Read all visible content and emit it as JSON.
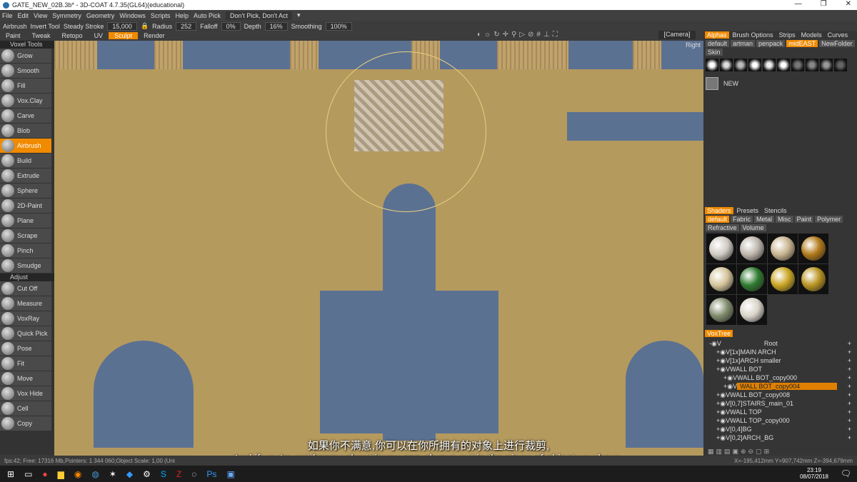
{
  "title": "GATE_NEW_02B.3b* - 3D-COAT 4.7.35(GL64)(educational)",
  "menu": [
    "File",
    "Edit",
    "View",
    "Symmetry",
    "Geometry",
    "Windows",
    "Scripts",
    "Help"
  ],
  "auto_pick": "Auto Pick",
  "pick_mode": "Don't Pick, Don't Act",
  "toolopts": {
    "tool": "Airbrush",
    "invert": "Invert Tool",
    "steady": "Steady Stroke",
    "steady_val": "15,000",
    "radius": "Radius",
    "radius_val": "252",
    "falloff": "Falloff",
    "falloff_val": "0%",
    "depth": "Depth",
    "depth_val": "16%",
    "smoothing": "Smoothing",
    "smoothing_val": "100%"
  },
  "rooms": [
    "Paint",
    "Tweak",
    "Retopo",
    "UV",
    "Sculpt",
    "Render"
  ],
  "camera": "[Camera]",
  "view_label": "Right",
  "left": {
    "voxel_header": "Voxel Tools",
    "tools": [
      "Grow",
      "Smooth",
      "Fill",
      "Vox.Clay",
      "Carve",
      "Blob",
      "Airbrush",
      "Build",
      "Extrude",
      "Sphere",
      "2D-Paint",
      "Plane",
      "Scrape",
      "Pinch",
      "Smudge"
    ],
    "adjust_header": "Adjust",
    "adjust": [
      "Cut Off",
      "Measure",
      "VoxRay",
      "Quick Pick",
      "Pose",
      "Fit",
      "Move",
      "Vox Hide",
      "Cell",
      "Copy"
    ]
  },
  "alphas": {
    "tabs": [
      "Alphas",
      "Brush Options",
      "Strips",
      "Models",
      "Curves"
    ],
    "folders": [
      "default",
      "artman",
      "penpack",
      "midEAST",
      "NewFolder",
      "Skin"
    ],
    "new": "NEW"
  },
  "shaders": {
    "tabs": [
      "Shaders",
      "Presets",
      "Stencils"
    ],
    "cats": [
      "default",
      "Fabric",
      "Metal",
      "Misc",
      "Paint",
      "Polymer",
      "Refractive",
      "Volume"
    ],
    "colors": [
      "#cfcac2",
      "#bdb6ad",
      "#c8b48f",
      "#b07818",
      "#d4c49a",
      "#2f7a2f",
      "#c9a422",
      "#b89320",
      "#7f8b6c",
      "#d9d3c8"
    ]
  },
  "voxtree": {
    "title": "VoxTree",
    "items": [
      {
        "name": "Root",
        "indent": 0
      },
      {
        "name": "[1x]MAIN  ARCH",
        "indent": 1
      },
      {
        "name": "[1x]ARCH  smaller",
        "indent": 1
      },
      {
        "name": "WALL  BOT",
        "indent": 1
      },
      {
        "name": "WALL  BOT_copy000",
        "indent": 2
      },
      {
        "name": "WALL  BOT_copy004",
        "indent": 2,
        "selected": true
      },
      {
        "name": "WALL  BOT_copy008",
        "indent": 1
      },
      {
        "name": "[0,7]STAIRS_main_01",
        "indent": 1
      },
      {
        "name": "WALL  TOP",
        "indent": 1
      },
      {
        "name": "WALL  TOP_copy000",
        "indent": 1
      },
      {
        "name": "[0,4]BG",
        "indent": 1
      },
      {
        "name": "[0,2]ARCH_BG",
        "indent": 1
      }
    ]
  },
  "status": {
    "left": "fps:42;      Free: 17316 Mb,Pointers: 1 344 060;Object  Scale: 1,00 (Uni",
    "right": "X=-195,412mm  Y=907,742mm  Z=-394,679mm"
  },
  "subtitles": {
    "zh": "如果你不满意,你可以在你所拥有的对象上进行裁剪,",
    "en": "And if you're not happy about it,you can always cut in the piece of object you have,"
  },
  "taskbar": {
    "time": "23:19",
    "date": "08/07/2018"
  }
}
